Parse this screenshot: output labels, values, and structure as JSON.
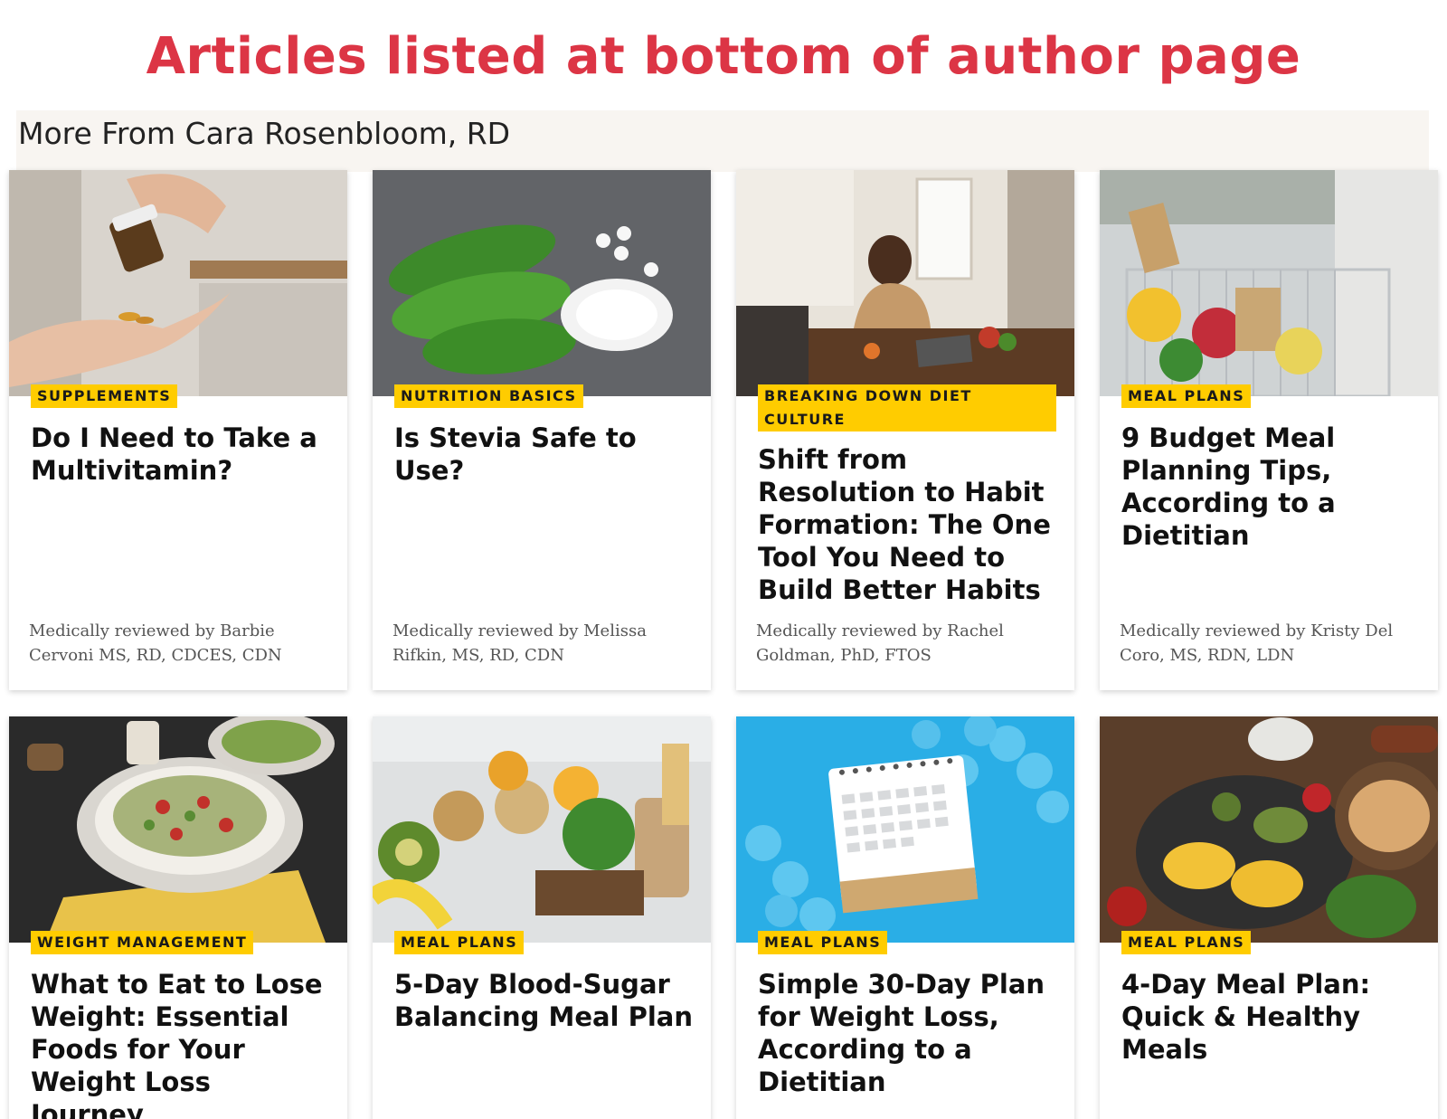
{
  "annotation": {
    "title": "Articles listed at bottom of author page"
  },
  "section": {
    "heading": "More From Cara Rosenbloom, RD"
  },
  "colors": {
    "annotation": "#dc3545",
    "tag_bg": "#ffcc00",
    "header_bg": "#f8f5f1"
  },
  "cards": [
    {
      "tag": "SUPPLEMENTS",
      "title": "Do I Need to Take a Multivitamin?",
      "reviewer": "Medically reviewed by Barbie Cervoni MS, RD, CDCES, CDN",
      "image": "pills-in-hand-photo"
    },
    {
      "tag": "NUTRITION BASICS",
      "title": "Is Stevia Safe to Use?",
      "reviewer": "Medically reviewed by Melissa Rifkin, MS, RD, CDN",
      "image": "stevia-leaves-photo"
    },
    {
      "tag": "BREAKING DOWN DIET CULTURE",
      "title": "Shift from Resolution to Habit Formation: The One Tool You Need to Build Better Habits",
      "reviewer": "Medically reviewed by Rachel Goldman, PhD, FTOS",
      "image": "woman-cooking-photo"
    },
    {
      "tag": "MEAL PLANS",
      "title": "9 Budget Meal Planning Tips, According to a Dietitian",
      "reviewer": "Medically reviewed by Kristy Del Coro, MS, RDN, LDN",
      "image": "grocery-cart-photo"
    },
    {
      "tag": "WEIGHT MANAGEMENT",
      "title": "What to Eat to Lose Weight: Essential Foods for Your Weight Loss Journey",
      "reviewer": "",
      "image": "salad-bowl-photo"
    },
    {
      "tag": "MEAL PLANS",
      "title": "5-Day Blood-Sugar Balancing Meal Plan",
      "reviewer": "",
      "image": "whole-foods-spread-photo"
    },
    {
      "tag": "MEAL PLANS",
      "title": "Simple 30-Day Plan for Weight Loss, According to a Dietitian",
      "reviewer": "",
      "image": "calendar-blue-balls-photo"
    },
    {
      "tag": "MEAL PLANS",
      "title": "4-Day Meal Plan: Quick & Healthy Meals",
      "reviewer": "",
      "image": "grilled-chicken-corn-photo"
    }
  ]
}
